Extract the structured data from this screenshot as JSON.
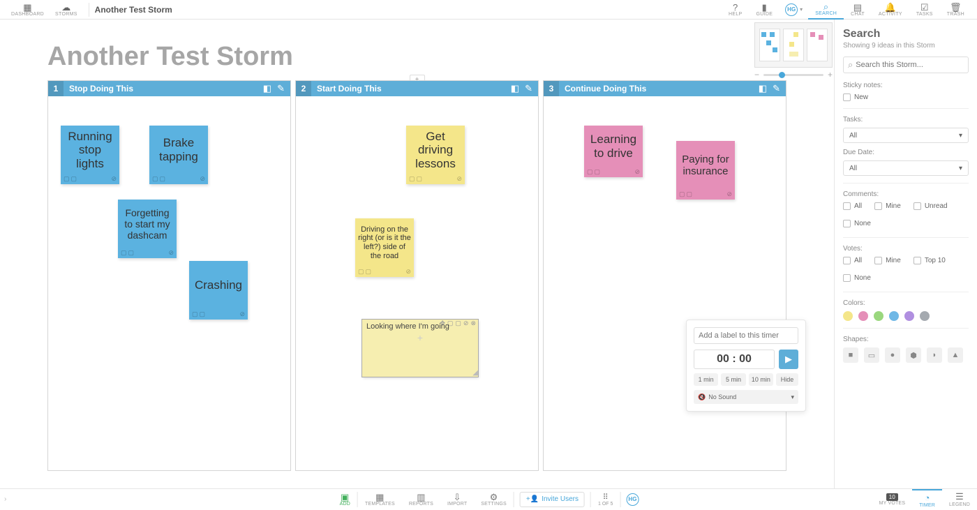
{
  "topbar": {
    "dashboard": "Dashboard",
    "storms": "Storms",
    "title": "Another Test Storm",
    "help": "Help",
    "guide": "Guide",
    "avatar": "HG",
    "search": "Search",
    "chat": "Chat",
    "activity": "Activity",
    "tasks": "Tasks",
    "trash": "Trash"
  },
  "page": {
    "title": "Another Test Storm"
  },
  "columns": [
    {
      "num": "1",
      "title": "Stop Doing This"
    },
    {
      "num": "2",
      "title": "Start Doing This"
    },
    {
      "num": "3",
      "title": "Continue Doing This"
    }
  ],
  "notes": {
    "c1n1": "Running stop lights",
    "c1n2": "Brake tapping",
    "c1n3": "Forgetting to start my dashcam",
    "c1n4": "Crashing",
    "c2n1": "Get driving lessons",
    "c2n2": "Driving on the right (or is it the left?) side of the road",
    "c2n3": "Looking where I'm going",
    "c3n1": "Learning to drive",
    "c3n2": "Paying for insurance"
  },
  "searchPanel": {
    "title": "Search",
    "subtitle": "Showing 9 ideas in this Storm",
    "placeholder": "Search this Storm...",
    "stickyNotesLabel": "Sticky notes:",
    "newLabel": "New",
    "tasksLabel": "Tasks:",
    "allOption": "All",
    "dueDateLabel": "Due Date:",
    "commentsLabel": "Comments:",
    "commentsAll": "All",
    "commentsMine": "Mine",
    "commentsUnread": "Unread",
    "commentsNone": "None",
    "votesLabel": "Votes:",
    "votesAll": "All",
    "votesMine": "Mine",
    "votesTop10": "Top 10",
    "votesNone": "None",
    "colorsLabel": "Colors:",
    "shapesLabel": "Shapes:"
  },
  "timer": {
    "labelPlaceholder": "Add a label to this timer",
    "display": "00 : 00",
    "preset1": "1 min",
    "preset5": "5 min",
    "preset10": "10 min",
    "hide": "Hide",
    "noSound": "No Sound"
  },
  "bottombar": {
    "add": "Add",
    "templates": "Templates",
    "reports": "Reports",
    "import": "Import",
    "settings": "Settings",
    "invite": "Invite Users",
    "pages": "1 of 5",
    "avatar": "HG",
    "votesBadge": "10",
    "myVotes": "My Votes",
    "timer": "Timer",
    "legend": "Legend"
  }
}
